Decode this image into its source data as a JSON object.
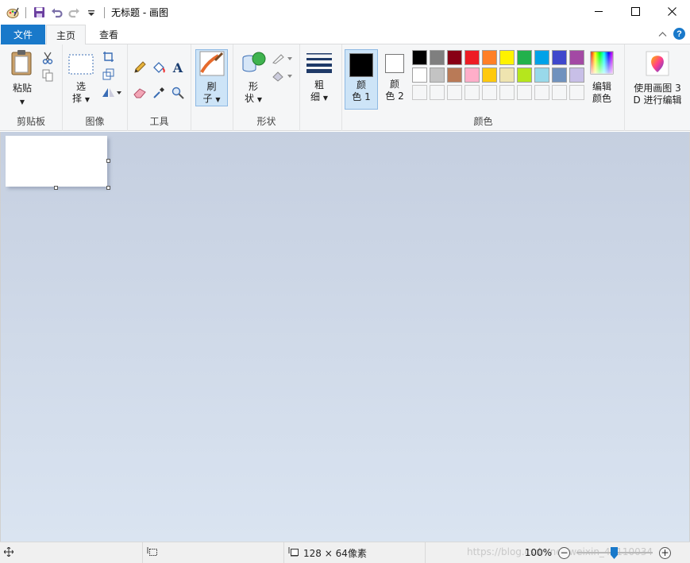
{
  "window": {
    "title": "无标题 - 画图",
    "minimize_icon": "minimize-icon",
    "maximize_icon": "maximize-icon",
    "close_icon": "close-icon"
  },
  "tabs": [
    {
      "label": "文件"
    },
    {
      "label": "主页"
    },
    {
      "label": "查看"
    }
  ],
  "ribbon": {
    "clipboard": {
      "label": "剪贴板",
      "paste": "粘贴"
    },
    "image": {
      "label": "图像",
      "select_1": "选",
      "select_2": "择"
    },
    "tools": {
      "label": "工具"
    },
    "brushes": {
      "line1": "刷",
      "line2": "子"
    },
    "shapes": {
      "label": "形状",
      "line1": "形",
      "line2": "状"
    },
    "size": {
      "line1": "粗",
      "line2": "细"
    },
    "colors": {
      "label": "颜色",
      "color1_line1": "颜",
      "color1_line2": "色 1",
      "color2_line1": "颜",
      "color2_line2": "色 2",
      "edit_line1": "编辑",
      "edit_line2": "颜色",
      "palette_row1": [
        "#000000",
        "#7f7f7f",
        "#880015",
        "#ed1c24",
        "#ff7f27",
        "#fff200",
        "#22b14c",
        "#00a2e8",
        "#3f48cc",
        "#a349a4"
      ],
      "palette_row2": [
        "#ffffff",
        "#c3c3c3",
        "#b97a57",
        "#ffaec9",
        "#ffc90e",
        "#efe4b0",
        "#b5e61d",
        "#99d9ea",
        "#7092be",
        "#c8bfe7"
      ],
      "primary": "#000000",
      "secondary": "#ffffff"
    },
    "paint3d": {
      "line1": "使用画图 3",
      "line2": "D 进行编辑"
    }
  },
  "status": {
    "canvas_size": "128 × 64像素",
    "zoom": "100%",
    "watermark": "https://blog.csdn.net/weixin_41110034"
  }
}
